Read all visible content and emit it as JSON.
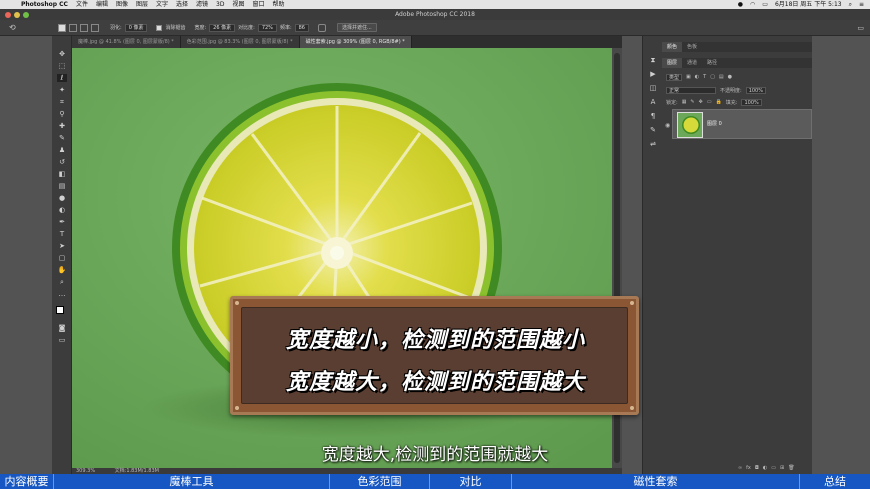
{
  "menubar": {
    "app_name": "Photoshop CC",
    "items": [
      "文件",
      "编辑",
      "图像",
      "图层",
      "文字",
      "选择",
      "滤镜",
      "3D",
      "视图",
      "窗口",
      "帮助"
    ],
    "clock": "6月18日 周五 下午 5:13"
  },
  "window": {
    "title": "Adobe Photoshop CC 2018"
  },
  "options": {
    "feather_label": "羽化:",
    "feather_value": "0 像素",
    "antialias_label": "消除锯齿",
    "width_label": "宽度:",
    "width_value": "26 像素",
    "contrast_label": "对比度:",
    "contrast_value": "72%",
    "frequency_label": "频率:",
    "frequency_value": "86",
    "select_mask_button": "选择并遮住..."
  },
  "tabs": [
    {
      "label": "魔棒.jpg @ 41.8% (图层 0, 图层蒙版/8) *"
    },
    {
      "label": "色彩范围.jpg @ 83.3% (图层 0, 图层蒙版/8) *"
    },
    {
      "label": "磁性套索.jpg @ 309% (图层 0, RGB/8#) *"
    }
  ],
  "status": {
    "zoom": "309.3%",
    "doc": "文档:1.83M/1.83M"
  },
  "panel": {
    "top_tabs": [
      "颜色",
      "色板"
    ],
    "layer_tabs": [
      "图层",
      "通道",
      "路径"
    ],
    "filter_kind": "类型",
    "blend_mode": "正常",
    "opacity_label": "不透明度:",
    "opacity_value": "100%",
    "lock_label": "锁定:",
    "fill_label": "填充:",
    "fill_value": "100%",
    "layer_name": "图层 0"
  },
  "overlay": {
    "sign_line1": "宽度越小，检测到的范围越小",
    "sign_line2": "宽度越大，检测到的范围越大",
    "subtitle": "宽度越大,检测到的范围就越大"
  },
  "chapters": [
    "内容概要",
    "魔棒工具",
    "色彩范围",
    "对比",
    "磁性套索",
    "总结"
  ],
  "colors": {
    "canvas_green": "#6ba859",
    "chapter_bar": "#1657c3",
    "sign_wood": "#8a5633",
    "sign_board": "#5a3e31"
  }
}
